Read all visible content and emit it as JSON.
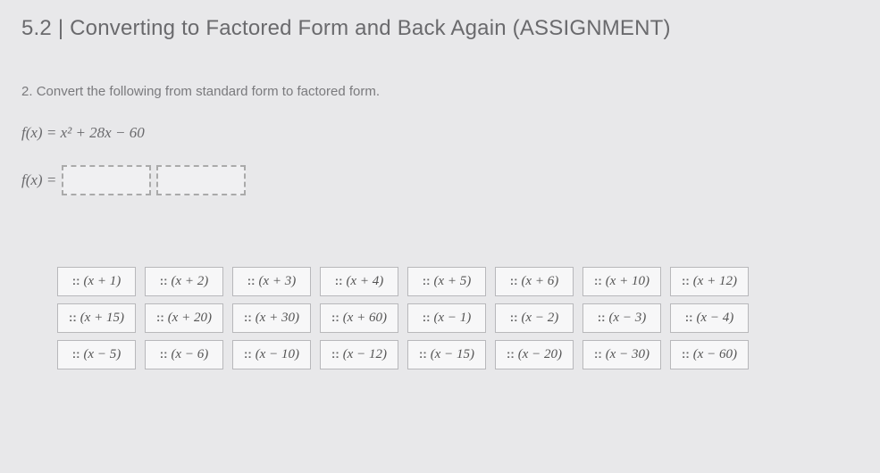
{
  "title": "5.2 | Converting to Factored Form and Back Again (ASSIGNMENT)",
  "question": {
    "number": "2.",
    "text": "Convert the following from standard form to factored form."
  },
  "given_formula": "f(x) = x² + 28x − 60",
  "answer_prefix": "f(x) =",
  "tile_handle": "::",
  "tiles": {
    "row1": [
      "(x + 1)",
      "(x + 2)",
      "(x + 3)",
      "(x + 4)",
      "(x + 5)",
      "(x + 6)",
      "(x + 10)",
      "(x + 12)"
    ],
    "row2": [
      "(x + 15)",
      "(x + 20)",
      "(x + 30)",
      "(x + 60)",
      "(x − 1)",
      "(x − 2)",
      "(x − 3)",
      "(x − 4)"
    ],
    "row3": [
      "(x − 5)",
      "(x − 6)",
      "(x − 10)",
      "(x − 12)",
      "(x − 15)",
      "(x − 20)",
      "(x − 30)",
      "(x − 60)"
    ]
  }
}
